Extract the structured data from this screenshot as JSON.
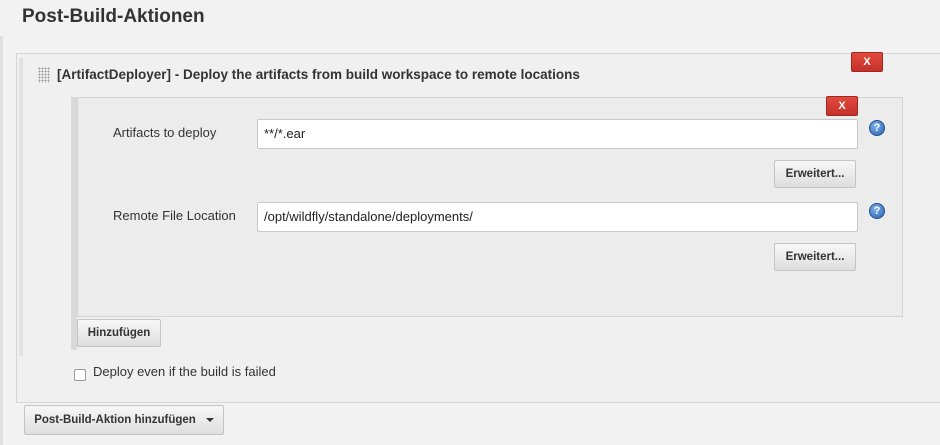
{
  "section": {
    "title": "Post-Build-Aktionen"
  },
  "deployer": {
    "title": "[ArtifactDeployer] - Deploy the artifacts from build workspace to remote locations",
    "delete_label": "X",
    "entry_delete_label": "X",
    "fields": [
      {
        "label": "Artifacts to deploy",
        "value": "**/*.ear",
        "advanced_label": "Erweitert..."
      },
      {
        "label": "Remote File Location",
        "value": "/opt/wildfly/standalone/deployments/",
        "advanced_label": "Erweitert..."
      }
    ],
    "help_glyph": "?",
    "add_label": "Hinzufügen",
    "checkbox": {
      "label": "Deploy even if the build is failed",
      "checked": false
    }
  },
  "footer": {
    "add_action_label": "Post-Build-Aktion hinzufügen",
    "dropdown_icon": "caret-down-icon"
  },
  "icons": [
    "drag-handle-icon",
    "help-icon",
    "caret-down-icon"
  ],
  "colors": {
    "delete_red": "#d33a2f",
    "help_blue": "#2b62b0"
  }
}
